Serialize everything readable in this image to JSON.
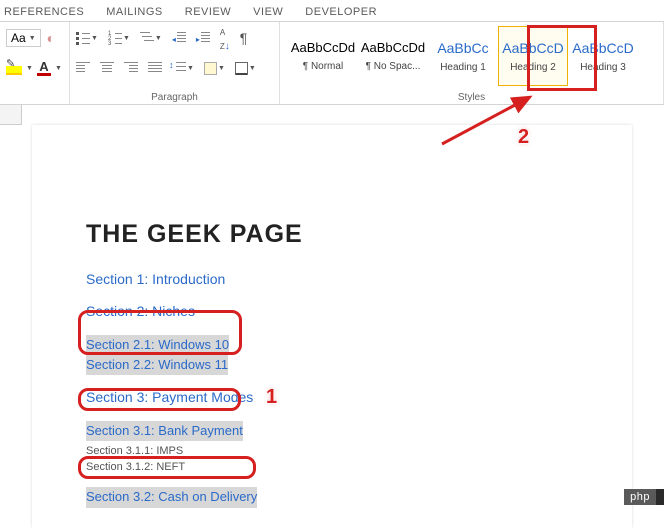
{
  "tabs": [
    "REFERENCES",
    "MAILINGS",
    "REVIEW",
    "VIEW",
    "DEVELOPER"
  ],
  "font": {
    "size": "Aa"
  },
  "groups": {
    "paragraph": "Paragraph",
    "styles": "Styles"
  },
  "styles": [
    {
      "preview": "AaBbCcDd",
      "name": "¶ Normal",
      "heading": false
    },
    {
      "preview": "AaBbCcDd",
      "name": "¶ No Spac...",
      "heading": false
    },
    {
      "preview": "AaBbCc",
      "name": "Heading 1",
      "heading": true
    },
    {
      "preview": "AaBbCcD",
      "name": "Heading 2",
      "heading": true
    },
    {
      "preview": "AaBbCcD",
      "name": "Heading 3",
      "heading": true
    }
  ],
  "doc": {
    "title": "THE GEEK PAGE",
    "s1": "Section 1: Introduction",
    "s2": "Section 2: Niches",
    "s21": "Section 2.1: Windows 10",
    "s22": "Section 2.2: Windows 11",
    "s3": "Section 3: Payment Modes",
    "s31": "Section 3.1: Bank Payment",
    "s311": "Section 3.1.1: IMPS",
    "s312": "Section 3.1.2: NEFT",
    "s32": "Section 3.2: Cash on Delivery"
  },
  "annotations": {
    "one": "1",
    "two": "2"
  },
  "watermark": "php"
}
